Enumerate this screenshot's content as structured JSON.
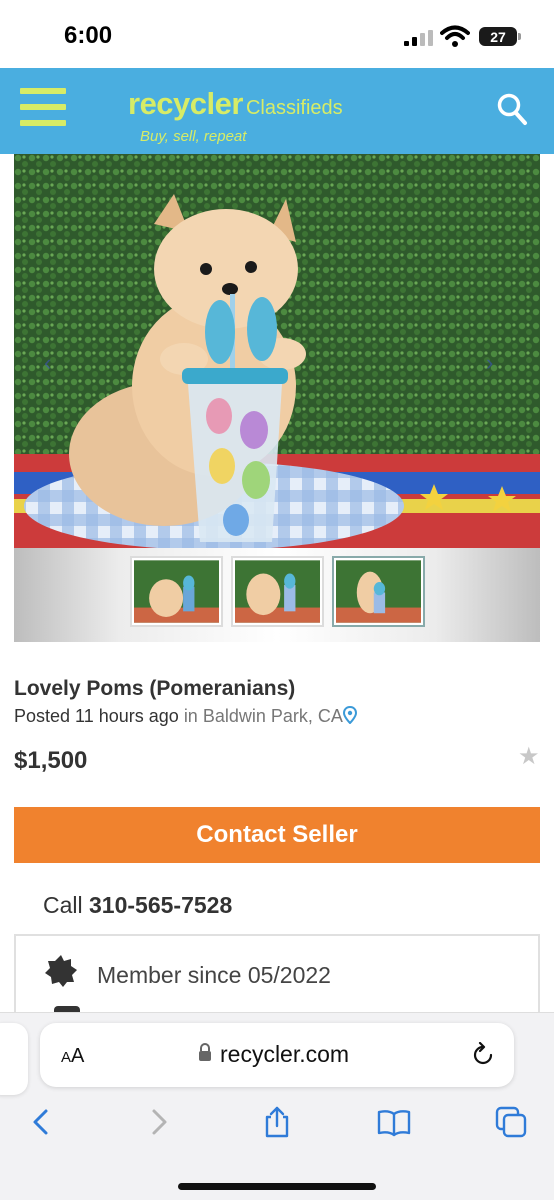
{
  "status_bar": {
    "time": "6:00",
    "battery": "27"
  },
  "header": {
    "logo_main": "recycler",
    "logo_sub": "Classifieds",
    "tagline": "Buy, sell, repeat",
    "icons": {
      "menu": "hamburger-menu-icon",
      "search": "search-icon"
    },
    "colors": {
      "header_bg": "#4aaee0",
      "logo": "#d7ec66"
    }
  },
  "gallery": {
    "thumbnail_count": 3,
    "active_thumbnail": 3,
    "icons": {
      "prev": "chevron-left-icon",
      "next": "chevron-right-icon"
    },
    "arrow_prev": "‹",
    "arrow_next": "›"
  },
  "listing": {
    "title": "Lovely Poms (Pomeranians)",
    "posted": "Posted 11 hours ago",
    "location_prefix": "in Baldwin Park, CA",
    "price": "$1,500",
    "favorite_glyph": "★"
  },
  "contact": {
    "button_label": "Contact Seller",
    "call_prefix": "Call",
    "phone": "310-565-7528",
    "colors": {
      "button_bg": "#f0822e"
    }
  },
  "member": {
    "since": "Member since 05/2022"
  },
  "browser": {
    "aa_small": "A",
    "aa_large": "A",
    "url": "recycler.com",
    "icons": [
      "back-icon",
      "forward-icon",
      "share-icon",
      "bookmarks-icon",
      "tabs-icon"
    ]
  }
}
